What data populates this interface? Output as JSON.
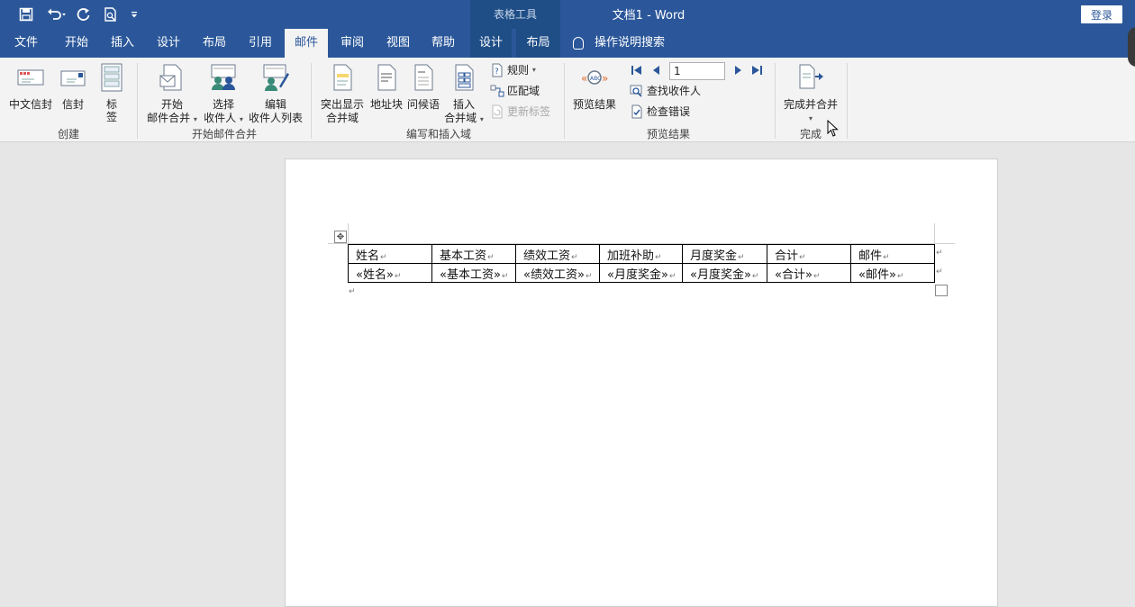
{
  "titlebar": {
    "context_tab_group": "表格工具",
    "document_title": "文档1  -  Word",
    "login_label": "登录"
  },
  "tabs": [
    {
      "label": "文件"
    },
    {
      "label": "开始"
    },
    {
      "label": "插入"
    },
    {
      "label": "设计"
    },
    {
      "label": "布局"
    },
    {
      "label": "引用"
    },
    {
      "label": "邮件"
    },
    {
      "label": "审阅"
    },
    {
      "label": "视图"
    },
    {
      "label": "帮助"
    },
    {
      "label": "设计"
    },
    {
      "label": "布局"
    }
  ],
  "tell_me": "操作说明搜索",
  "ribbon": {
    "create": {
      "label": "创建",
      "chinese_envelope": "中文信封",
      "envelope": "信封",
      "label_btn": "标\n签"
    },
    "start_merge": {
      "label": "开始邮件合并",
      "start_line1": "开始",
      "start_line2": "邮件合并",
      "select_line1": "选择",
      "select_line2": "收件人",
      "edit_line1": "编辑",
      "edit_line2": "收件人列表"
    },
    "write_insert": {
      "label": "编写和插入域",
      "highlight_line1": "突出显示",
      "highlight_line2": "合并域",
      "address_block": "地址块",
      "greeting_line": "问候语",
      "insert_line1": "插入",
      "insert_line2": "合并域",
      "rules": "规则",
      "match_fields": "匹配域",
      "update_labels": "更新标签"
    },
    "preview": {
      "label": "预览结果",
      "preview_results": "预览结果",
      "record_value": "1",
      "find_recipient": "查找收件人",
      "check_errors": "检查错误"
    },
    "finish": {
      "label": "完成",
      "finish_merge": "完成并合并"
    }
  },
  "table": {
    "headers": [
      "姓名",
      "基本工资",
      "绩效工资",
      "加班补助",
      "月度奖金",
      "合计",
      "邮件"
    ],
    "fields": [
      "«姓名»",
      "«基本工资»",
      "«绩效工资»",
      "«月度奖金»",
      "«月度奖金»",
      "«合计»",
      "«邮件»"
    ]
  },
  "colors": {
    "title_blue": "#2b579a",
    "context_blue": "#1f4e87",
    "ribbon_bg": "#f3f3f3",
    "canvas_bg": "#e6e6e6"
  }
}
